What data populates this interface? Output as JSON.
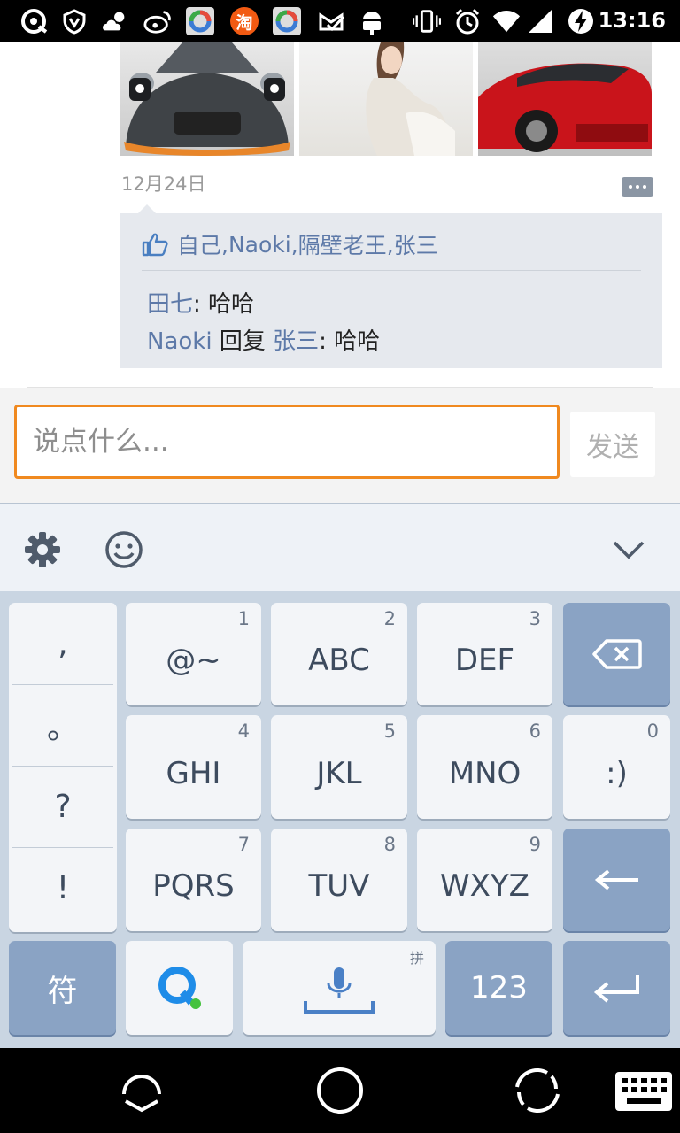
{
  "status_bar": {
    "time": "13:16",
    "notification_icons": [
      "qq-browser-icon",
      "shield-icon",
      "weather-icon",
      "weibo-icon",
      "app-store-icon",
      "taobao-icon",
      "app-store-icon",
      "mail-check-icon",
      "android-icon"
    ],
    "taobao_label": "淘",
    "system_icons": [
      "vibrate-icon",
      "alarm-icon",
      "wifi-icon",
      "signal-icon",
      "charging-icon"
    ]
  },
  "feed": {
    "photos": [
      "car-photo-black",
      "girl-photo",
      "car-photo-red"
    ],
    "date": "12月24日",
    "likes": [
      "自己",
      "Naoki",
      "隔壁老王",
      "张三"
    ],
    "likes_sep": ",",
    "comments": [
      {
        "user": "田七",
        "text": "哈哈"
      },
      {
        "user": "Naoki",
        "reply_word": "回复",
        "reply_to": "张三",
        "text": "哈哈"
      }
    ]
  },
  "composer": {
    "placeholder": "说点什么...",
    "send_label": "发送"
  },
  "keyboard": {
    "punctuation": [
      ",",
      "。",
      "?",
      "!"
    ],
    "keys": [
      {
        "num": "1",
        "label": "@~"
      },
      {
        "num": "2",
        "label": "ABC"
      },
      {
        "num": "3",
        "label": "DEF"
      },
      {
        "num": "4",
        "label": "GHI"
      },
      {
        "num": "5",
        "label": "JKL"
      },
      {
        "num": "6",
        "label": "MNO"
      },
      {
        "num": "0",
        "label": ":)"
      },
      {
        "num": "7",
        "label": "PQRS"
      },
      {
        "num": "8",
        "label": "TUV"
      },
      {
        "num": "9",
        "label": "WXYZ"
      }
    ],
    "symbol_key": "符",
    "numeric_key": "123",
    "space_mode": "拼"
  },
  "colors": {
    "accent_orange": "#f0891f",
    "link_blue": "#5d79a8",
    "key_dark": "#8aa3c4"
  }
}
